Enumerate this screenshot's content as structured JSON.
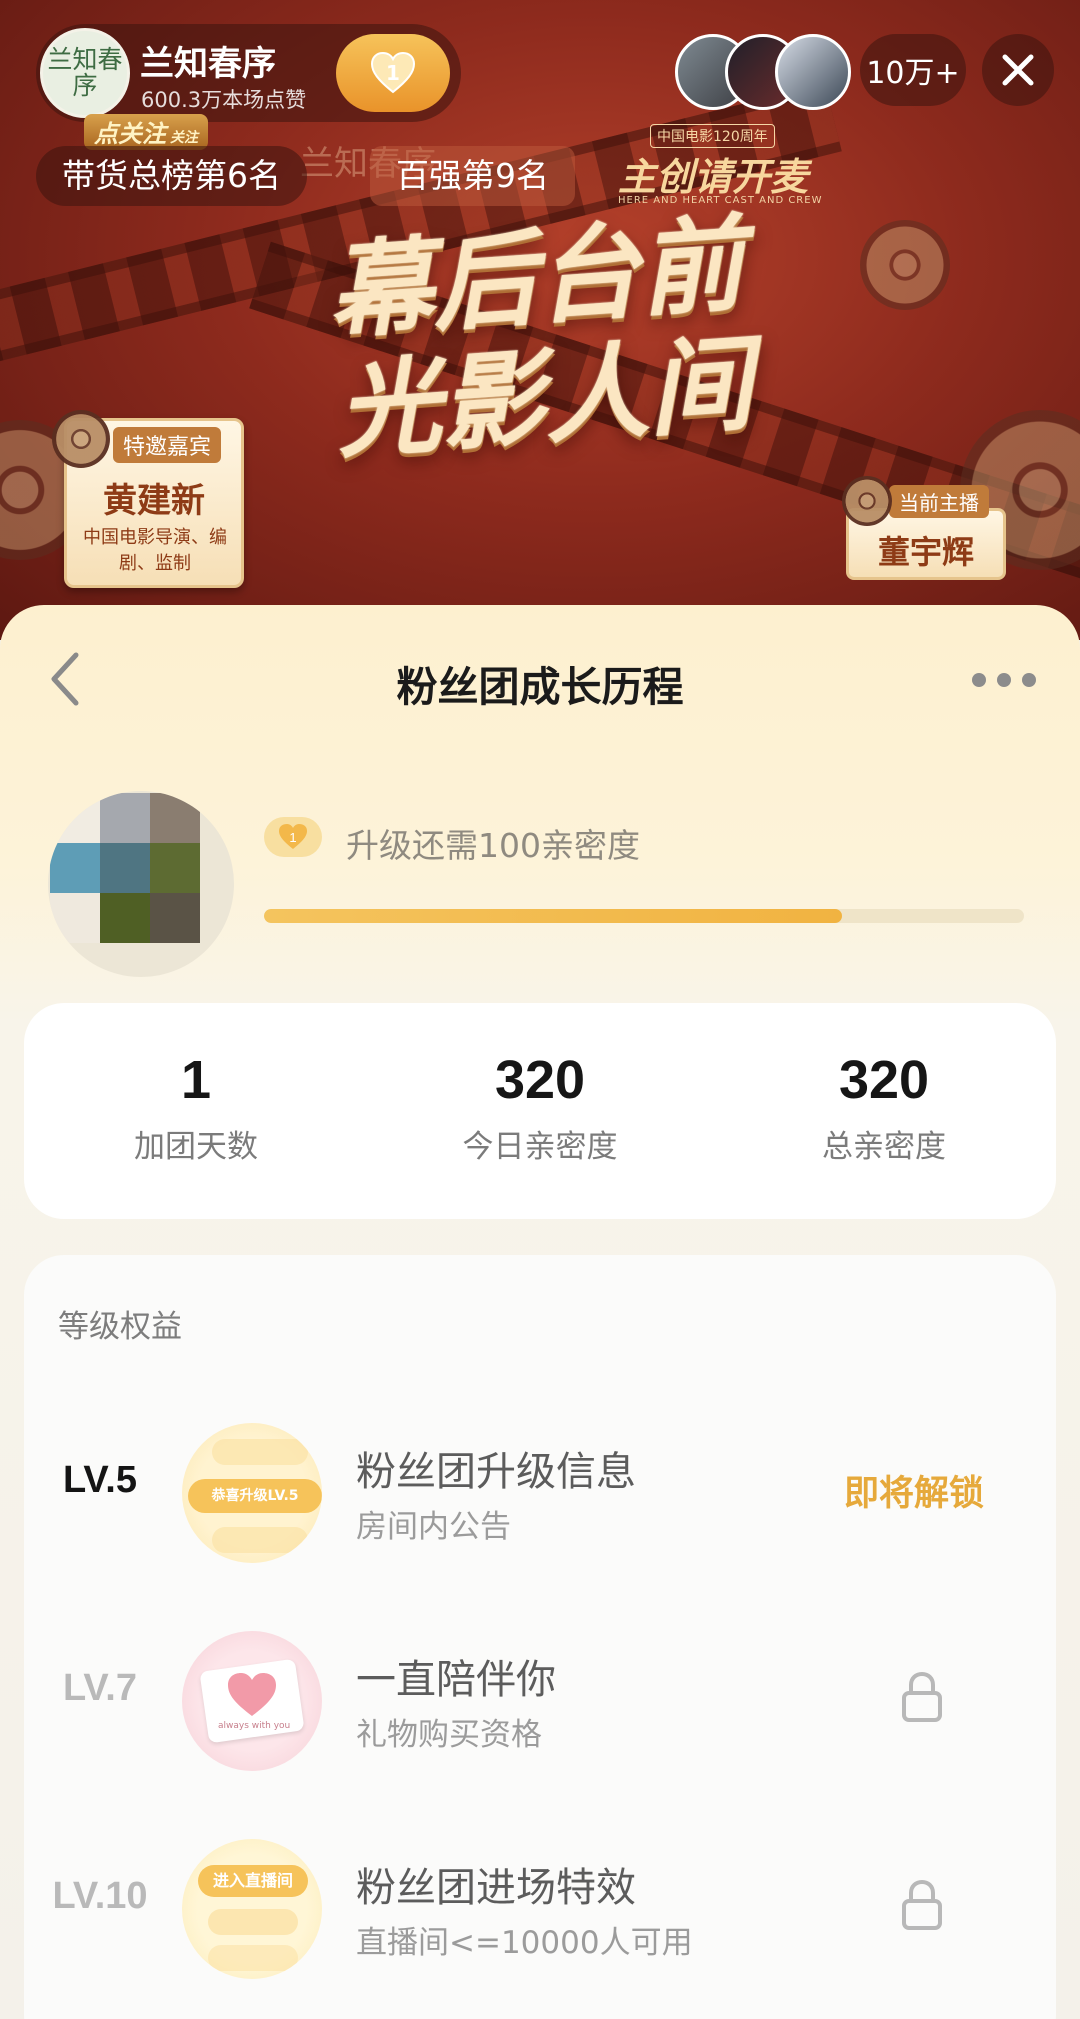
{
  "stream": {
    "anchor_name": "兰知春序",
    "anchor_logo_text": "兰知春序",
    "likes_text": "600.3万本场点赞",
    "fan_level": "1",
    "viewer_count": "10万+",
    "follow_tag": "点关注",
    "follow_sub": "关注",
    "rank_sales": "带货总榜第6名",
    "rank_hundred": "百强第9名",
    "logo_ghost": "兰知春序",
    "brand_mark": "主创请开麦",
    "brand_sub": "中国电影120周年",
    "brand_caption": "HERE AND HEART CAST AND CREW",
    "slogan_line1": "幕后台前",
    "slogan_line2": "光影人间",
    "guest_tag": "特邀嘉宾",
    "guest_name": "黄建新",
    "guest_desc": "中国电影导演、编剧、监制",
    "host_tag": "当前主播",
    "host_name": "董宇辉"
  },
  "sheet": {
    "title": "粉丝团成长历程",
    "upgrade_badge": "1",
    "upgrade_text": "升级还需100亲密度",
    "progress": 0.76,
    "stats": [
      {
        "value": "1",
        "label": "加团天数"
      },
      {
        "value": "320",
        "label": "今日亲密度"
      },
      {
        "value": "320",
        "label": "总亲密度"
      }
    ],
    "benefits_label": "等级权益",
    "benefits": [
      {
        "level": "LV.5",
        "title": "粉丝团升级信息",
        "subtitle": "房间内公告",
        "status": "即将解锁",
        "thumb_text": "恭喜升级LV.5"
      },
      {
        "level": "LV.7",
        "title": "一直陪伴你",
        "subtitle": "礼物购买资格",
        "status": "locked",
        "thumb_text": "always with you"
      },
      {
        "level": "LV.10",
        "title": "粉丝团进场特效",
        "subtitle": "直播间<=10000人可用",
        "status": "locked",
        "thumb_text": "进入直播间"
      }
    ]
  },
  "colors": {
    "accent": "#e6a93b",
    "progress": "#f1b341",
    "stream_bg": "#8d2a1d"
  },
  "icons": [
    "back-arrow-icon",
    "more-icon",
    "close-icon",
    "heart-icon",
    "lock-icon",
    "film-reel-icon"
  ]
}
